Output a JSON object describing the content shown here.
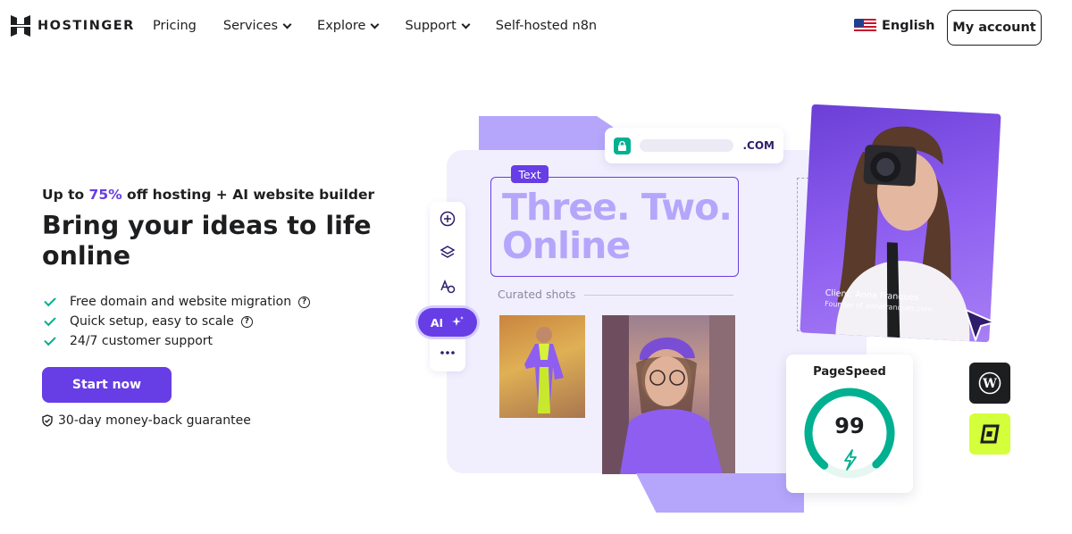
{
  "header": {
    "logo_text": "HOSTINGER",
    "nav": [
      {
        "label": "Pricing",
        "dropdown": false
      },
      {
        "label": "Services",
        "dropdown": true
      },
      {
        "label": "Explore",
        "dropdown": true
      },
      {
        "label": "Support",
        "dropdown": true
      },
      {
        "label": "Self-hosted n8n",
        "dropdown": false
      }
    ],
    "language": "English",
    "account_button": "My account"
  },
  "hero": {
    "promo_prefix": "Up to ",
    "promo_highlight": "75%",
    "promo_suffix": " off hosting + AI website builder",
    "title": "Bring your ideas to life online",
    "features": [
      {
        "text": "Free domain and website migration",
        "help": true
      },
      {
        "text": "Quick setup, easy to scale",
        "help": true
      },
      {
        "text": "24/7 customer support",
        "help": false
      }
    ],
    "cta": "Start now",
    "guarantee": "30-day money-back guarantee"
  },
  "illustration": {
    "domain_suffix": ".COM",
    "text_tag": "Text",
    "headline": "Three. Two. Online",
    "curated_label": "Curated shots",
    "ai_label": "AI",
    "client_name": "Client: Anna Franques",
    "client_role": "Founder of annafranques.com",
    "pagespeed_label": "PageSpeed",
    "pagespeed_score": "99",
    "pagespeed_value": 99
  },
  "colors": {
    "brand": "#673de6",
    "accent_light": "#b5a6fb",
    "success": "#00b090",
    "text": "#1d1e20"
  }
}
